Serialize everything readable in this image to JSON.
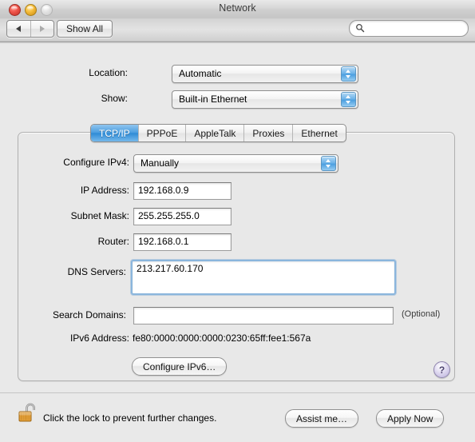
{
  "window": {
    "title": "Network",
    "controls": {
      "close": "close-button",
      "minimize": "minimize-button",
      "zoom": "zoom-button"
    }
  },
  "toolbar": {
    "back_label": "back-arrow",
    "forward_label": "forward-arrow",
    "show_all_label": "Show All",
    "search": {
      "icon": "search-icon",
      "value": "",
      "placeholder": ""
    }
  },
  "top_form": {
    "location": {
      "label": "Location:",
      "value": "Automatic"
    },
    "show": {
      "label": "Show:",
      "value": "Built-in Ethernet"
    }
  },
  "tabs": [
    {
      "label": "TCP/IP",
      "selected": true
    },
    {
      "label": "PPPoE",
      "selected": false
    },
    {
      "label": "AppleTalk",
      "selected": false
    },
    {
      "label": "Proxies",
      "selected": false
    },
    {
      "label": "Ethernet",
      "selected": false
    }
  ],
  "tcpip": {
    "configure_ipv4": {
      "label": "Configure IPv4:",
      "value": "Manually"
    },
    "ip_address": {
      "label": "IP Address:",
      "value": "192.168.0.9"
    },
    "subnet_mask": {
      "label": "Subnet Mask:",
      "value": "255.255.255.0"
    },
    "router": {
      "label": "Router:",
      "value": "192.168.0.1"
    },
    "dns_servers": {
      "label": "DNS Servers:",
      "value": "213.217.60.170",
      "focused": true
    },
    "search_domains": {
      "label": "Search Domains:",
      "value": "",
      "hint": "(Optional)"
    },
    "ipv6_address": {
      "label": "IPv6 Address:",
      "value": "fe80:0000:0000:0000:0230:65ff:fee1:567a"
    },
    "configure_ipv6_label": "Configure IPv6…",
    "help_label": "?"
  },
  "bottom_bar": {
    "lock_icon": "lock-open-icon",
    "lock_message": "Click the lock to prevent further changes.",
    "assist_label": "Assist me…",
    "apply_label": "Apply Now"
  },
  "colors": {
    "accent_blue": "#4e9fe0",
    "focus_ring": "#8bb6dd",
    "help_purple": "#b9b0da",
    "window_bg": "#e9e9e9"
  }
}
